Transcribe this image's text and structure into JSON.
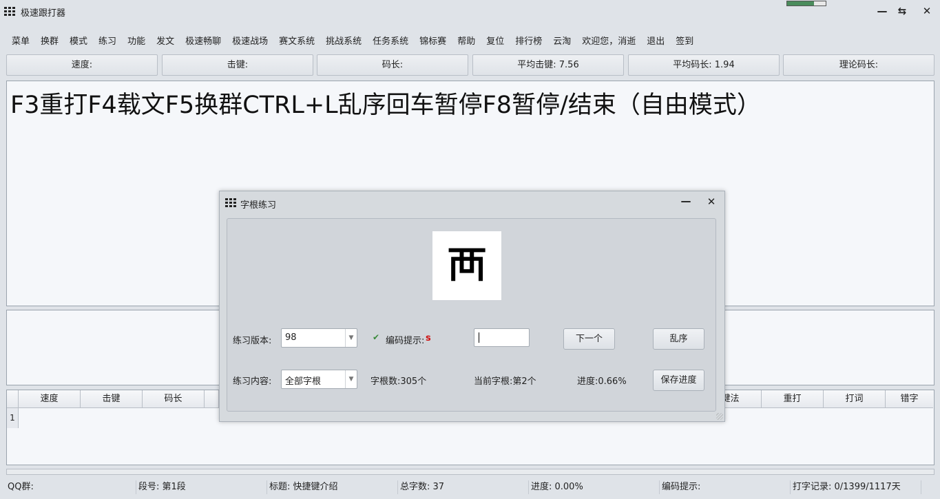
{
  "window": {
    "title": "极速跟打器"
  },
  "menu": [
    "菜单",
    "换群",
    "模式",
    "练习",
    "功能",
    "发文",
    "极速畅聊",
    "极速战场",
    "赛文系统",
    "挑战系统",
    "任务系统",
    "锦标赛",
    "帮助",
    "复位",
    "排行榜",
    "云淘",
    "欢迎您，消逝",
    "退出",
    "签到"
  ],
  "stats": {
    "speed": "速度:",
    "keystroke": "击键:",
    "code_length": "码长:",
    "avg_keystroke": "平均击键: 7.56",
    "avg_code_length": "平均码长: 1.94",
    "theory_code_length": "理论码长:"
  },
  "main_text": "F3重打F4载文F5换群CTRL+L乱序回车暂停F8暂停/结束（自由模式）",
  "table": {
    "headers_left": [
      "速度",
      "击键",
      "码长"
    ],
    "headers_right": [
      "键法",
      "重打",
      "打词",
      "错字"
    ],
    "row_number": "1"
  },
  "status": {
    "qq": "QQ群:",
    "segment": "段号: 第1段",
    "title": "标题: 快捷键介绍",
    "total": "总字数: 37",
    "progress": "进度: 0.00%",
    "hint": "编码提示:",
    "record": "打字记录: 0/1399/1117天"
  },
  "dialog": {
    "title": "字根练习",
    "character": "襾",
    "version_label": "练习版本:",
    "version_value": "98",
    "hint_label": "编码提示:",
    "hint_value": "s",
    "next_button": "下一个",
    "shuffle_button": "乱序",
    "content_label": "练习内容:",
    "content_value": "全部字根",
    "root_count": "字根数:305个",
    "current_root": "当前字根:第2个",
    "progress": "进度:0.66%",
    "save_button": "保存进度"
  },
  "colors": {
    "background": "#dfe3e8",
    "panel": "#f5f7fa",
    "hint_red": "#d01010",
    "check_green": "#3a8a3a"
  }
}
